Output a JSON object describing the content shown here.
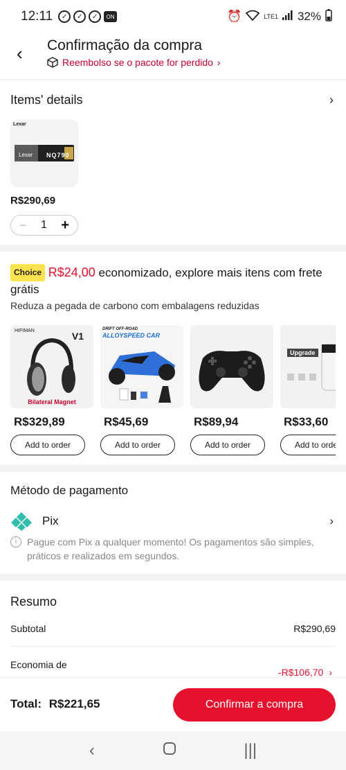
{
  "status_bar": {
    "time": "12:11",
    "battery": "32%",
    "network": "LTE1"
  },
  "header": {
    "title": "Confirmação da compra",
    "subtitle": "Reembolso se o pacote for perdido",
    "subtitle_chevron": "›"
  },
  "items": {
    "title": "Items' details",
    "product": {
      "brand": "Lexar",
      "model": "NQ790",
      "price": "R$290,69",
      "quantity": "1"
    }
  },
  "choice": {
    "badge": "Choice",
    "saved_amount": "R$24,00",
    "message": "economizado, explore mais itens com frete grátis",
    "subtext": "Reduza a pegada de carbono com embalagens reduzidas",
    "products": [
      {
        "price": "R$329,89",
        "button": "Add to order",
        "label": "V1",
        "caption": "Bilateral Magnet",
        "brand": "HIFIMAN"
      },
      {
        "price": "R$45,69",
        "button": "Add to order",
        "label": "ALLOYSPEED CAR",
        "caption": "DRIFT OFF-ROAD"
      },
      {
        "price": "R$89,94",
        "button": "Add to order"
      },
      {
        "price": "R$33,60",
        "button": "Add to order",
        "label": "Upgrade"
      }
    ]
  },
  "payment": {
    "title": "Método de pagamento",
    "method": "Pix",
    "info": "Pague com Pix a qualquer momento! Os pagamentos são simples, práticos e realizados em segundos."
  },
  "summary": {
    "title": "Resumo",
    "subtotal_label": "Subtotal",
    "subtotal_value": "R$290,69",
    "discount_label": "Economia de",
    "discount_value": "-R$106,70"
  },
  "footer": {
    "total_label": "Total:",
    "total_value": "R$221,65",
    "confirm_label": "Confirmar a compra"
  },
  "colors": {
    "accent": "#e8112d",
    "choice_badge": "#ffe24d",
    "pix": "#32bcad"
  }
}
